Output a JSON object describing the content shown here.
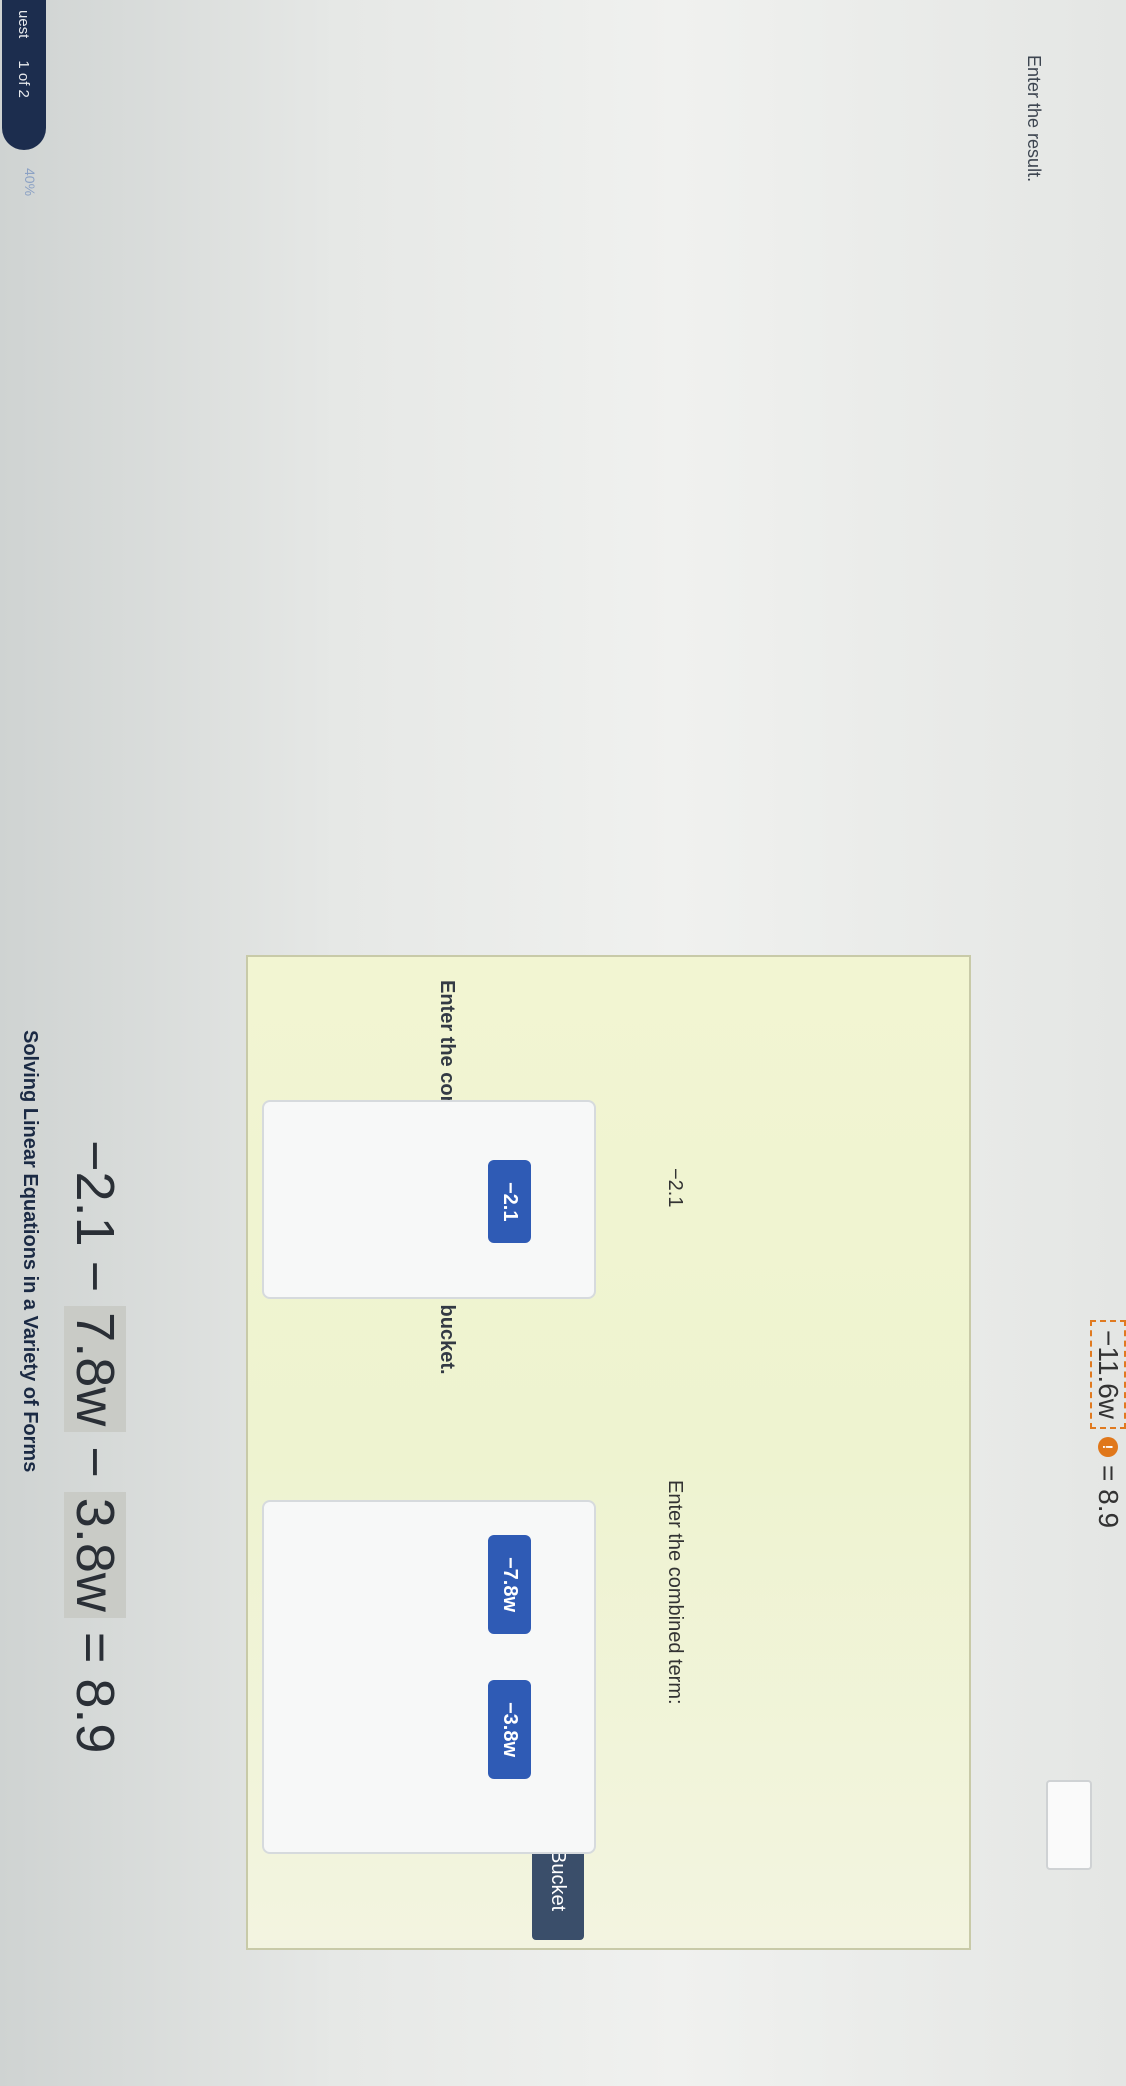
{
  "progress": {
    "label": "uest",
    "counter": "1 of 2",
    "percent": "40%"
  },
  "title": "Solving Linear Equations in a Variety of Forms",
  "left_prompt": "Enter the result.",
  "equation": {
    "terms": [
      "−2.1",
      "−",
      "7.8w",
      "−",
      "3.8w"
    ],
    "rhs": "= 8.9"
  },
  "panel": {
    "instruction": "Enter the combined term for each bucket.",
    "add_bucket_label": "Add Bucket",
    "buckets": [
      {
        "chips": [
          "−2.1"
        ],
        "result": "−2.1"
      },
      {
        "chips": [
          "−7.8w",
          "−3.8w"
        ],
        "combined_label": "Enter the combined term:",
        "input_value": ""
      }
    ]
  },
  "result_row": {
    "term": "−11.6w",
    "rhs": "= 8.9"
  },
  "colors": {
    "chip": "#2f5bb5",
    "panel": "#eef3d0",
    "button": "#3a4e6a",
    "warning": "#e0771a"
  }
}
